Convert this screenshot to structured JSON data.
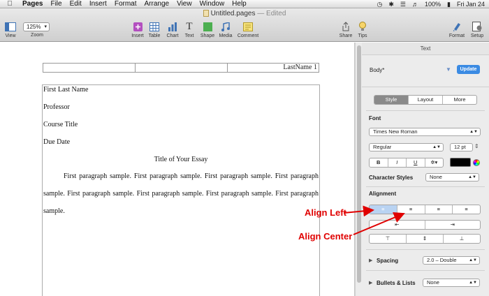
{
  "menubar": {
    "app": "Pages",
    "items": [
      "File",
      "Edit",
      "Insert",
      "Format",
      "Arrange",
      "View",
      "Window",
      "Help"
    ],
    "battery": "100%",
    "datetime": "Fri Jan 24"
  },
  "window": {
    "filename": "Untitled.pages",
    "status": "— Edited"
  },
  "toolbar": {
    "view_label": "View",
    "zoom_value": "125%",
    "zoom_label": "Zoom",
    "insert_label": "Insert",
    "table_label": "Table",
    "chart_label": "Chart",
    "text_label": "Text",
    "shape_label": "Shape",
    "media_label": "Media",
    "comment_label": "Comment",
    "share_label": "Share",
    "tips_label": "Tips",
    "format_label": "Format",
    "setup_label": "Setup"
  },
  "document": {
    "header_right": "LastName 1",
    "lines": [
      "First Last Name",
      "Professor",
      "Course Title",
      "Due Date"
    ],
    "title": "Title of Your Essay",
    "paragraph": "First paragraph sample. First paragraph sample. First paragraph sample. First paragraph sample. First paragraph sample. First paragraph sample. First paragraph sample. First paragraph sample."
  },
  "inspector": {
    "header": "Text",
    "paragraph_style": "Body*",
    "update_label": "Update",
    "tabs": [
      "Style",
      "Layout",
      "More"
    ],
    "font_label": "Font",
    "font_family": "Times New Roman",
    "font_style": "Regular",
    "font_size": "12 pt",
    "bold": "B",
    "italic": "I",
    "underline": "U",
    "gear": "✲▾",
    "char_styles_label": "Character Styles",
    "char_styles_value": "None",
    "alignment_label": "Alignment",
    "spacing_label": "Spacing",
    "spacing_value": "2.0 – Double",
    "bullets_label": "Bullets & Lists",
    "bullets_value": "None"
  },
  "annotations": {
    "align_left": "Align Left",
    "align_center": "Align Center"
  }
}
